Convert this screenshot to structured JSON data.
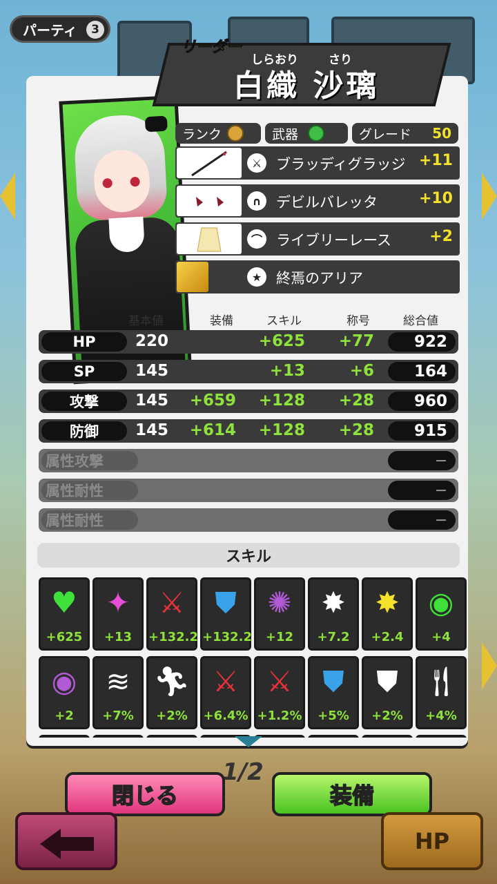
{
  "party": {
    "label": "パーティ",
    "number": "3"
  },
  "character": {
    "leader_label": "リーダー",
    "ruby_given": "しらおり",
    "ruby_family": "さり",
    "name": "白織 沙璃"
  },
  "info": {
    "rank_label": "ランク",
    "weapon_label": "武器",
    "grade_label": "グレード",
    "grade_value": "50"
  },
  "equipment": [
    {
      "name": "ブラッディグラッジ",
      "plus": "+11",
      "icon": "sword-icon"
    },
    {
      "name": "デビルバレッタ",
      "plus": "+10",
      "icon": "headphone-icon"
    },
    {
      "name": "ライブリーレース",
      "plus": "+2",
      "icon": "cape-icon"
    },
    {
      "name": "終焉のアリア",
      "plus": "",
      "icon": "star-icon"
    }
  ],
  "stats": {
    "headers": [
      "基本値",
      "装備",
      "スキル",
      "称号",
      "総合値"
    ],
    "rows": [
      {
        "label": "HP",
        "base": "220",
        "equip": "",
        "skill": "+625",
        "title": "+77",
        "total": "922"
      },
      {
        "label": "SP",
        "base": "145",
        "equip": "",
        "skill": "+13",
        "title": "+6",
        "total": "164"
      },
      {
        "label": "攻撃",
        "base": "145",
        "equip": "+659",
        "skill": "+128",
        "title": "+28",
        "total": "960"
      },
      {
        "label": "防御",
        "base": "145",
        "equip": "+614",
        "skill": "+128",
        "title": "+28",
        "total": "915"
      },
      {
        "label": "属性攻撃",
        "base": "",
        "equip": "",
        "skill": "",
        "title": "",
        "total": "－"
      },
      {
        "label": "属性耐性",
        "base": "",
        "equip": "",
        "skill": "",
        "title": "",
        "total": "－"
      },
      {
        "label": "属性耐性",
        "base": "",
        "equip": "",
        "skill": "",
        "title": "",
        "total": "－"
      }
    ]
  },
  "skills": {
    "title": "スキル",
    "items": [
      {
        "value": "+625",
        "icon": "heart-icon"
      },
      {
        "value": "+13",
        "icon": "sparkle-icon"
      },
      {
        "value": "+132.2",
        "icon": "sword-icon"
      },
      {
        "value": "+132.2",
        "icon": "shield-icon"
      },
      {
        "value": "+12",
        "icon": "swirl-icon"
      },
      {
        "value": "+7.2",
        "icon": "critical-icon"
      },
      {
        "value": "+2.4",
        "icon": "critical-icon"
      },
      {
        "value": "+4",
        "icon": "heart-ring-icon"
      },
      {
        "value": "+2",
        "icon": "sparkle-ring-icon"
      },
      {
        "value": "+7%",
        "icon": "dash-icon"
      },
      {
        "value": "+2%",
        "icon": "run-icon"
      },
      {
        "value": "+6.4%",
        "icon": "sword-burst-icon"
      },
      {
        "value": "+1.2%",
        "icon": "sword-burst-icon"
      },
      {
        "value": "+5%",
        "icon": "shield-percent-icon"
      },
      {
        "value": "+2%",
        "icon": "shield-icon"
      },
      {
        "value": "+4%",
        "icon": "cutlery-icon"
      }
    ]
  },
  "pager": {
    "text": "1/2"
  },
  "buttons": {
    "close": "閉じる",
    "equip": "装備",
    "hp": "HP"
  }
}
